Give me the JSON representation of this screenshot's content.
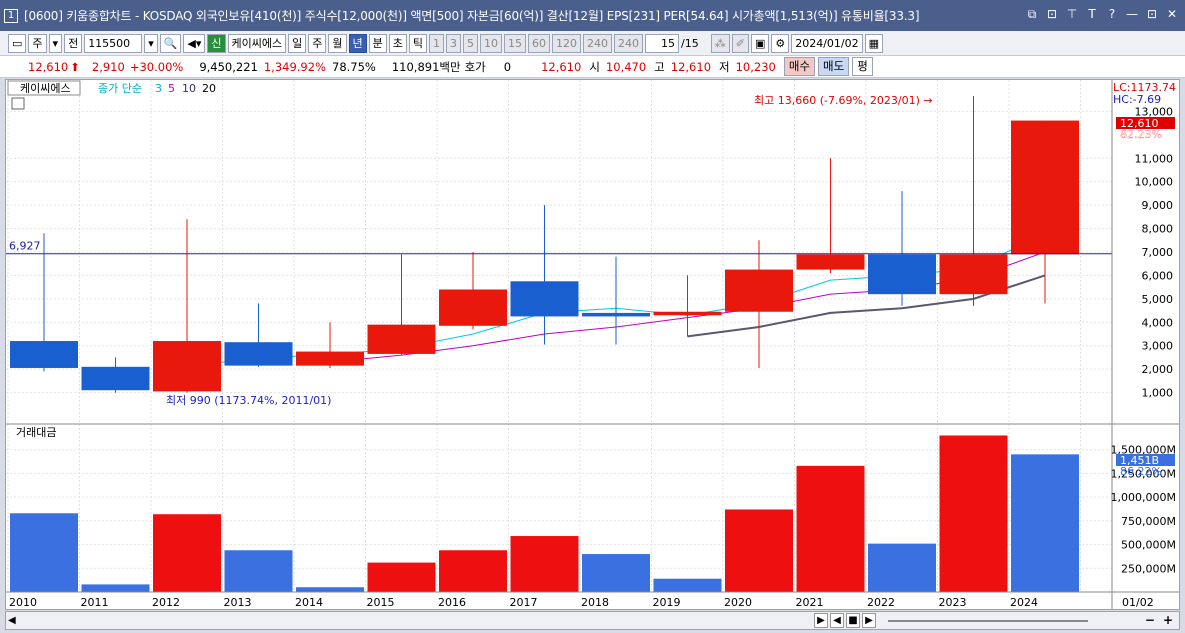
{
  "window": {
    "number": "1",
    "title": "[0600] 키움종합차트 - KOSDAQ 외국인보유[410(천)] 주식수[12,000(천)] 액면[500] 자본금[60(억)] 결산[12월] EPS[231] PER[54.64] 시가총액[1,513(억)] 유통비율[33.3]",
    "buttons": [
      "⧉",
      "⊡",
      "⊤",
      "T",
      "?",
      "—",
      "⊡",
      "✕"
    ]
  },
  "toolbar": {
    "period_toggle": "주",
    "jeon": "전",
    "code": "115500",
    "new_badge": "신",
    "stock_name": "케이씨에스",
    "periods": [
      "일",
      "주",
      "월",
      "년",
      "분",
      "초",
      "틱"
    ],
    "selected_period": "년",
    "intervals": [
      "1",
      "3",
      "5",
      "10",
      "15",
      "60",
      "120",
      "240"
    ],
    "interval_select": "240",
    "page": "15",
    "page_total": "/15",
    "date": "2024/01/02"
  },
  "quote": {
    "price": "12,610",
    "change": "2,910",
    "change_pct": "+30.00%",
    "volume": "9,450,221",
    "volume_ratio": "1,349.92%",
    "turnover": "78.75%",
    "amount": "110,891백만",
    "hoga_label": "호가",
    "hoga_value": "0",
    "hoga_price": "12,610",
    "open_label": "시",
    "open": "10,470",
    "high_label": "고",
    "high": "12,610",
    "low_label": "저",
    "low": "10,230",
    "buy": "매수",
    "sell": "매도",
    "avg": "평"
  },
  "price_panel": {
    "stock_label": "케이씨에스",
    "ma_label": "종가 단순",
    "ma_periods": [
      "3",
      "5",
      "10",
      "20"
    ],
    "ma_colors": [
      "#00c8e0",
      "#c000c0",
      "#303060",
      "#505080"
    ],
    "lc_label": "LC:1173.74",
    "hc_label": "HC:-7.69",
    "current_price_tag": "12,610",
    "current_pct_tag": "82.23%",
    "hline_label": "6,927",
    "hline_value": 6927,
    "high_annotation": "최고 13,660 (-7.69%, 2023/01) →",
    "low_annotation": "최저 990 (1173.74%, 2011/01)",
    "y_ticks": [
      "13,000",
      "11,000",
      "10,000",
      "9,000",
      "8,000",
      "7,000",
      "6,000",
      "5,000",
      "4,000",
      "3,000",
      "2,000",
      "1,000"
    ]
  },
  "volume_panel": {
    "label": "거래대금",
    "current_tag": "1,451B",
    "current_pct_tag": "86.22%",
    "y_ticks": [
      "1,500,000M",
      "1,250,000M",
      "1,000,000M",
      "750,000M",
      "500,000M",
      "250,000M"
    ]
  },
  "x_axis": [
    "2010",
    "2011",
    "2012",
    "2013",
    "2014",
    "2015",
    "2016",
    "2017",
    "2018",
    "2019",
    "2020",
    "2021",
    "2022",
    "2023",
    "2024",
    "01/02"
  ],
  "chart_data": {
    "type": "candlestick",
    "categories": [
      "2010",
      "2011",
      "2012",
      "2013",
      "2014",
      "2015",
      "2016",
      "2017",
      "2018",
      "2019",
      "2020",
      "2021",
      "2022",
      "2023",
      "2024"
    ],
    "candles": [
      {
        "o": 3200,
        "h": 7800,
        "l": 1900,
        "c": 2050
      },
      {
        "o": 2100,
        "h": 2500,
        "l": 990,
        "c": 1100
      },
      {
        "o": 1050,
        "h": 8400,
        "l": 1000,
        "c": 3200
      },
      {
        "o": 3150,
        "h": 4800,
        "l": 2100,
        "c": 2150
      },
      {
        "o": 2150,
        "h": 4000,
        "l": 2050,
        "c": 2750
      },
      {
        "o": 2650,
        "h": 6900,
        "l": 2600,
        "c": 3900
      },
      {
        "o": 3850,
        "h": 7000,
        "l": 3700,
        "c": 5400
      },
      {
        "o": 5750,
        "h": 9000,
        "l": 3050,
        "c": 4250
      },
      {
        "o": 4400,
        "h": 6800,
        "l": 3050,
        "c": 4250
      },
      {
        "o": 4300,
        "h": 6000,
        "l": 3400,
        "c": 4450
      },
      {
        "o": 4450,
        "h": 7500,
        "l": 2050,
        "c": 6250
      },
      {
        "o": 6250,
        "h": 11000,
        "l": 6100,
        "c": 6900
      },
      {
        "o": 6900,
        "h": 9600,
        "l": 4700,
        "c": 5200
      },
      {
        "o": 5200,
        "h": 13660,
        "l": 4700,
        "c": 6900
      },
      {
        "o": 6900,
        "h": 12610,
        "l": 4800,
        "c": 12610
      }
    ],
    "ma3": [
      null,
      null,
      2100,
      2500,
      2600,
      2900,
      3500,
      4400,
      4600,
      4300,
      4800,
      5800,
      6000,
      6300,
      7800
    ],
    "ma5": [
      null,
      null,
      null,
      null,
      2300,
      2600,
      3000,
      3500,
      3800,
      4200,
      4600,
      5200,
      5400,
      5900,
      7000
    ],
    "ma10": [
      null,
      null,
      null,
      null,
      null,
      null,
      null,
      null,
      null,
      3400,
      3800,
      4400,
      4600,
      5000,
      6000
    ],
    "volume_amount_m": [
      830000,
      80000,
      820000,
      440000,
      50000,
      310000,
      440000,
      590000,
      400000,
      140000,
      870000,
      1330000,
      510000,
      1650000,
      1451000
    ],
    "volume_color": [
      "blue",
      "blue",
      "red",
      "blue",
      "blue",
      "red",
      "red",
      "red",
      "blue",
      "blue",
      "red",
      "red",
      "blue",
      "red",
      "blue"
    ],
    "price_ylim": [
      0,
      14000
    ],
    "volume_ylim": [
      0,
      1750000
    ]
  }
}
